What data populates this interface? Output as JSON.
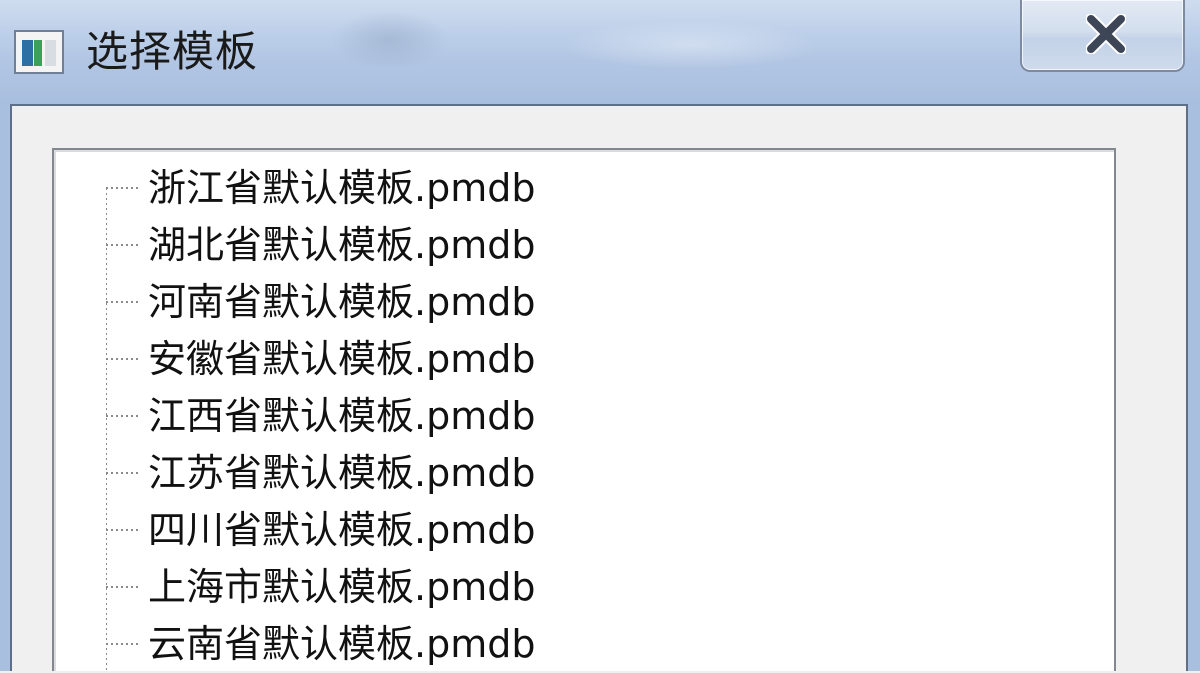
{
  "window": {
    "title": "选择模板",
    "close_label": "X"
  },
  "tree": {
    "items": [
      {
        "label": "浙江省默认模板.pmdb"
      },
      {
        "label": "湖北省默认模板.pmdb"
      },
      {
        "label": "河南省默认模板.pmdb"
      },
      {
        "label": "安徽省默认模板.pmdb"
      },
      {
        "label": "江西省默认模板.pmdb"
      },
      {
        "label": "江苏省默认模板.pmdb"
      },
      {
        "label": "四川省默认模板.pmdb"
      },
      {
        "label": "上海市默认模板.pmdb"
      },
      {
        "label": "云南省默认模板.pmdb"
      }
    ]
  },
  "colors": {
    "titlebar": "#b8cce7",
    "tree_background": "#ffffff",
    "text": "#111111"
  }
}
